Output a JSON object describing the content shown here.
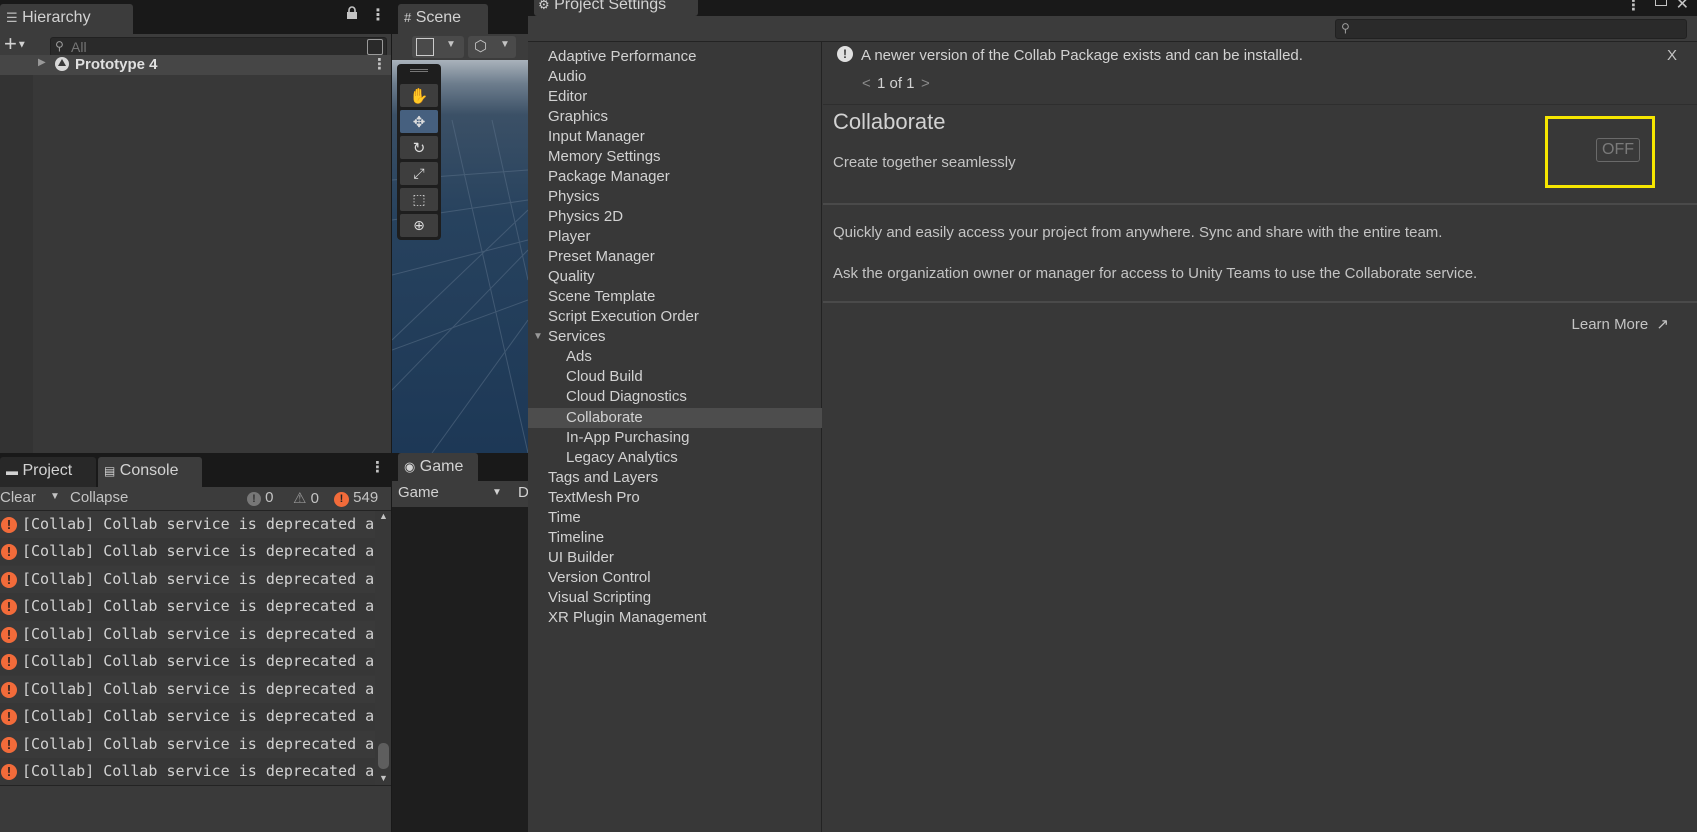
{
  "hierarchy": {
    "tab_label": "Hierarchy",
    "add_symbol": "+",
    "search_placeholder": "All",
    "root_item": "Prototype 4"
  },
  "scene": {
    "tab_label": "Scene"
  },
  "console_panel": {
    "project_tab": "Project",
    "console_tab": "Console",
    "clear_label": "Clear",
    "collapse_label": "Collapse",
    "info_count": "0",
    "warning_count": "0",
    "error_count": "549",
    "rows": [
      "[Collab] Collab service is deprecated a",
      "[Collab] Collab service is deprecated a",
      "[Collab] Collab service is deprecated a",
      "[Collab] Collab service is deprecated a",
      "[Collab] Collab service is deprecated a",
      "[Collab] Collab service is deprecated a",
      "[Collab] Collab service is deprecated a",
      "[Collab] Collab service is deprecated a",
      "[Collab] Collab service is deprecated a",
      "[Collab] Collab service is deprecated a"
    ]
  },
  "game": {
    "tab_label": "Game",
    "display_select": "Game",
    "display_select_2": "D"
  },
  "settings": {
    "title": "Project Settings",
    "nav": [
      "Adaptive Performance",
      "Audio",
      "Editor",
      "Graphics",
      "Input Manager",
      "Memory Settings",
      "Package Manager",
      "Physics",
      "Physics 2D",
      "Player",
      "Preset Manager",
      "Quality",
      "Scene Template",
      "Script Execution Order",
      "Services",
      "Ads",
      "Cloud Build",
      "Cloud Diagnostics",
      "Collaborate",
      "In-App Purchasing",
      "Legacy Analytics",
      "Tags and Layers",
      "TextMesh Pro",
      "Time",
      "Timeline",
      "UI Builder",
      "Version Control",
      "Visual Scripting",
      "XR Plugin Management"
    ],
    "selected_nav": "Collaborate",
    "notice": {
      "text": "A newer version of the Collab Package exists and can be installed.",
      "pager_prev": "<",
      "pager_text": "1 of 1",
      "pager_next": ">",
      "close": "X"
    },
    "service": {
      "title": "Collaborate",
      "subtitle": "Create together seamlessly",
      "toggle": "OFF",
      "desc1": "Quickly and easily access your project from anywhere. Sync and share with the entire team.",
      "desc2": "Ask the organization owner or manager for access to Unity Teams to use the Collaborate service.",
      "learn_more": "Learn More"
    },
    "highlight_color": "#f5e600"
  }
}
